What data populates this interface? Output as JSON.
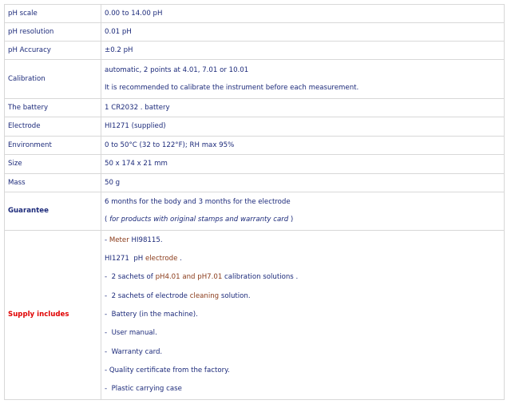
{
  "rows": [
    {
      "label": "pH scale",
      "value": "0.00 to 14.00 pH"
    },
    {
      "label": "pH resolution",
      "value": "0.01 pH"
    },
    {
      "label": "pH Accuracy",
      "value": "±0.2 pH"
    },
    {
      "label": "Calibration",
      "line1": "automatic, 2 points at 4.01, 7.01 or 10.01",
      "line2": "It is recommended to calibrate the instrument before each measurement."
    },
    {
      "label": "The battery",
      "value": "1 CR2032 . battery"
    },
    {
      "label": "Electrode",
      "value": "HI1271 (supplied)"
    },
    {
      "label": "Environment",
      "value": "0 to 50°C (32 to 122°F); RH max 95%"
    },
    {
      "label": "Size",
      "value": "50 x 174 x 21 mm"
    },
    {
      "label": "Mass",
      "value": "50 g"
    },
    {
      "label": "Guarantee",
      "line1": "6 months for the body and 3 months for the electrode",
      "line2_open": "( ",
      "line2_italic": "for products with original stamps and warranty card",
      "line2_close": " )"
    }
  ],
  "supply": {
    "label": "Supply includes",
    "items": [
      {
        "a": "- ",
        "b": "Meter",
        "c": " HI98115."
      },
      {
        "a": "HI1271  pH ",
        "b": "electrode",
        "c": " ."
      },
      {
        "a": "-  2 sachets of ",
        "b": "pH4.01 and pH7.01",
        "c": " calibration solutions ."
      },
      {
        "a": "-  2 sachets of electrode ",
        "b": "cleaning",
        "c": " solution."
      },
      {
        "a": "-  Battery (in the machine).",
        "b": "",
        "c": ""
      },
      {
        "a": "-  User manual.",
        "b": "",
        "c": ""
      },
      {
        "a": "-  Warranty card.",
        "b": "",
        "c": ""
      },
      {
        "a": "- Quality certificate from the factory.",
        "b": "",
        "c": ""
      },
      {
        "a": "-  Plastic carrying case",
        "b": "",
        "c": ""
      }
    ]
  }
}
